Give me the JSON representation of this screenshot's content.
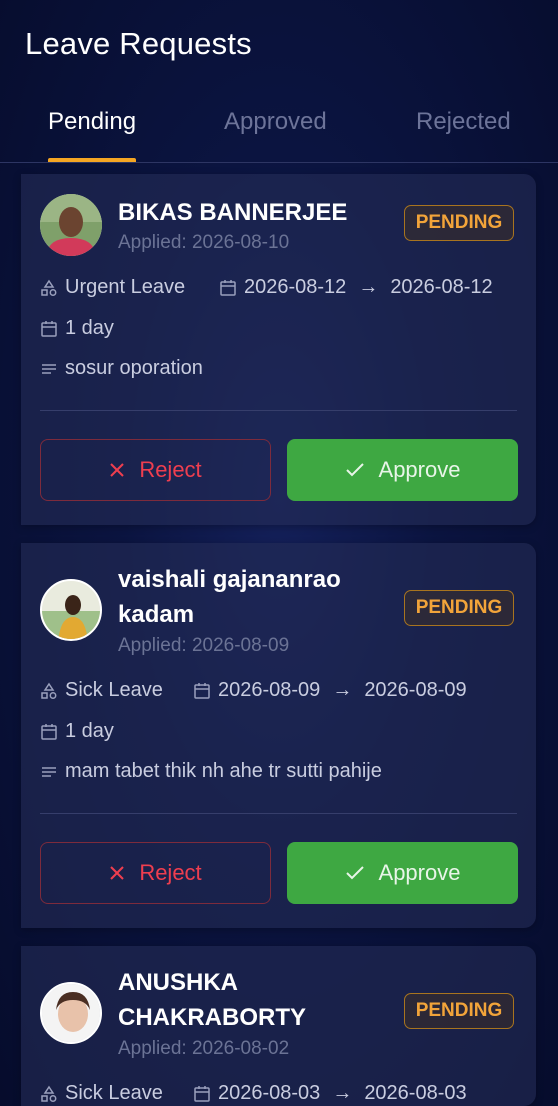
{
  "header": {
    "title": "Leave Requests"
  },
  "tabs": [
    {
      "label": "Pending",
      "active": true
    },
    {
      "label": "Approved",
      "active": false
    },
    {
      "label": "Rejected",
      "active": false
    }
  ],
  "colors": {
    "accent": "#f5a623",
    "approve": "#3ea842",
    "reject": "#ef3e4f",
    "badge": "#f2a43a"
  },
  "actions": {
    "reject_label": "Reject",
    "approve_label": "Approve"
  },
  "requests": [
    {
      "name": "BIKAS BANNERJEE",
      "applied": "Applied: 2026-08-10",
      "status": "PENDING",
      "leave_type": "Urgent Leave",
      "start": "2026-08-12",
      "end": "2026-08-12",
      "arrow": "→",
      "duration": "1 day",
      "reason": "sosur oporation"
    },
    {
      "name": "vaishali gajananrao kadam",
      "applied": "Applied: 2026-08-09",
      "status": "PENDING",
      "leave_type": "Sick Leave",
      "start": "2026-08-09",
      "end": "2026-08-09",
      "arrow": "→",
      "duration": "1 day",
      "reason": "mam tabet thik nh ahe tr sutti pahije"
    },
    {
      "name": "ANUSHKA CHAKRABORTY",
      "applied": "Applied: 2026-08-02",
      "status": "PENDING",
      "leave_type": "Sick Leave",
      "start": "2026-08-03",
      "end": "2026-08-03",
      "arrow": "→"
    }
  ]
}
